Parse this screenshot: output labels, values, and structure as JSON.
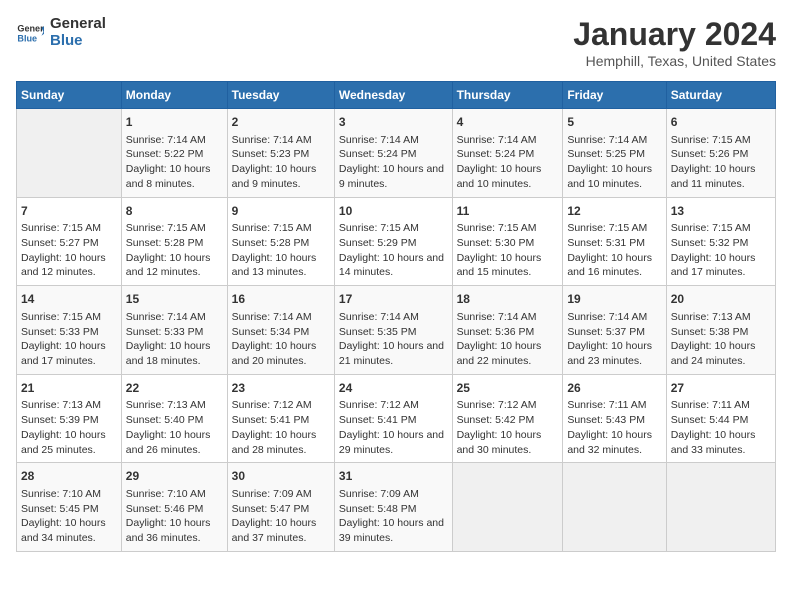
{
  "logo": {
    "text_general": "General",
    "text_blue": "Blue"
  },
  "title": "January 2024",
  "subtitle": "Hemphill, Texas, United States",
  "days_of_week": [
    "Sunday",
    "Monday",
    "Tuesday",
    "Wednesday",
    "Thursday",
    "Friday",
    "Saturday"
  ],
  "weeks": [
    [
      {
        "day": "",
        "sunrise": "",
        "sunset": "",
        "daylight": ""
      },
      {
        "day": "1",
        "sunrise": "Sunrise: 7:14 AM",
        "sunset": "Sunset: 5:22 PM",
        "daylight": "Daylight: 10 hours and 8 minutes."
      },
      {
        "day": "2",
        "sunrise": "Sunrise: 7:14 AM",
        "sunset": "Sunset: 5:23 PM",
        "daylight": "Daylight: 10 hours and 9 minutes."
      },
      {
        "day": "3",
        "sunrise": "Sunrise: 7:14 AM",
        "sunset": "Sunset: 5:24 PM",
        "daylight": "Daylight: 10 hours and 9 minutes."
      },
      {
        "day": "4",
        "sunrise": "Sunrise: 7:14 AM",
        "sunset": "Sunset: 5:24 PM",
        "daylight": "Daylight: 10 hours and 10 minutes."
      },
      {
        "day": "5",
        "sunrise": "Sunrise: 7:14 AM",
        "sunset": "Sunset: 5:25 PM",
        "daylight": "Daylight: 10 hours and 10 minutes."
      },
      {
        "day": "6",
        "sunrise": "Sunrise: 7:15 AM",
        "sunset": "Sunset: 5:26 PM",
        "daylight": "Daylight: 10 hours and 11 minutes."
      }
    ],
    [
      {
        "day": "7",
        "sunrise": "Sunrise: 7:15 AM",
        "sunset": "Sunset: 5:27 PM",
        "daylight": "Daylight: 10 hours and 12 minutes."
      },
      {
        "day": "8",
        "sunrise": "Sunrise: 7:15 AM",
        "sunset": "Sunset: 5:28 PM",
        "daylight": "Daylight: 10 hours and 12 minutes."
      },
      {
        "day": "9",
        "sunrise": "Sunrise: 7:15 AM",
        "sunset": "Sunset: 5:28 PM",
        "daylight": "Daylight: 10 hours and 13 minutes."
      },
      {
        "day": "10",
        "sunrise": "Sunrise: 7:15 AM",
        "sunset": "Sunset: 5:29 PM",
        "daylight": "Daylight: 10 hours and 14 minutes."
      },
      {
        "day": "11",
        "sunrise": "Sunrise: 7:15 AM",
        "sunset": "Sunset: 5:30 PM",
        "daylight": "Daylight: 10 hours and 15 minutes."
      },
      {
        "day": "12",
        "sunrise": "Sunrise: 7:15 AM",
        "sunset": "Sunset: 5:31 PM",
        "daylight": "Daylight: 10 hours and 16 minutes."
      },
      {
        "day": "13",
        "sunrise": "Sunrise: 7:15 AM",
        "sunset": "Sunset: 5:32 PM",
        "daylight": "Daylight: 10 hours and 17 minutes."
      }
    ],
    [
      {
        "day": "14",
        "sunrise": "Sunrise: 7:15 AM",
        "sunset": "Sunset: 5:33 PM",
        "daylight": "Daylight: 10 hours and 17 minutes."
      },
      {
        "day": "15",
        "sunrise": "Sunrise: 7:14 AM",
        "sunset": "Sunset: 5:33 PM",
        "daylight": "Daylight: 10 hours and 18 minutes."
      },
      {
        "day": "16",
        "sunrise": "Sunrise: 7:14 AM",
        "sunset": "Sunset: 5:34 PM",
        "daylight": "Daylight: 10 hours and 20 minutes."
      },
      {
        "day": "17",
        "sunrise": "Sunrise: 7:14 AM",
        "sunset": "Sunset: 5:35 PM",
        "daylight": "Daylight: 10 hours and 21 minutes."
      },
      {
        "day": "18",
        "sunrise": "Sunrise: 7:14 AM",
        "sunset": "Sunset: 5:36 PM",
        "daylight": "Daylight: 10 hours and 22 minutes."
      },
      {
        "day": "19",
        "sunrise": "Sunrise: 7:14 AM",
        "sunset": "Sunset: 5:37 PM",
        "daylight": "Daylight: 10 hours and 23 minutes."
      },
      {
        "day": "20",
        "sunrise": "Sunrise: 7:13 AM",
        "sunset": "Sunset: 5:38 PM",
        "daylight": "Daylight: 10 hours and 24 minutes."
      }
    ],
    [
      {
        "day": "21",
        "sunrise": "Sunrise: 7:13 AM",
        "sunset": "Sunset: 5:39 PM",
        "daylight": "Daylight: 10 hours and 25 minutes."
      },
      {
        "day": "22",
        "sunrise": "Sunrise: 7:13 AM",
        "sunset": "Sunset: 5:40 PM",
        "daylight": "Daylight: 10 hours and 26 minutes."
      },
      {
        "day": "23",
        "sunrise": "Sunrise: 7:12 AM",
        "sunset": "Sunset: 5:41 PM",
        "daylight": "Daylight: 10 hours and 28 minutes."
      },
      {
        "day": "24",
        "sunrise": "Sunrise: 7:12 AM",
        "sunset": "Sunset: 5:41 PM",
        "daylight": "Daylight: 10 hours and 29 minutes."
      },
      {
        "day": "25",
        "sunrise": "Sunrise: 7:12 AM",
        "sunset": "Sunset: 5:42 PM",
        "daylight": "Daylight: 10 hours and 30 minutes."
      },
      {
        "day": "26",
        "sunrise": "Sunrise: 7:11 AM",
        "sunset": "Sunset: 5:43 PM",
        "daylight": "Daylight: 10 hours and 32 minutes."
      },
      {
        "day": "27",
        "sunrise": "Sunrise: 7:11 AM",
        "sunset": "Sunset: 5:44 PM",
        "daylight": "Daylight: 10 hours and 33 minutes."
      }
    ],
    [
      {
        "day": "28",
        "sunrise": "Sunrise: 7:10 AM",
        "sunset": "Sunset: 5:45 PM",
        "daylight": "Daylight: 10 hours and 34 minutes."
      },
      {
        "day": "29",
        "sunrise": "Sunrise: 7:10 AM",
        "sunset": "Sunset: 5:46 PM",
        "daylight": "Daylight: 10 hours and 36 minutes."
      },
      {
        "day": "30",
        "sunrise": "Sunrise: 7:09 AM",
        "sunset": "Sunset: 5:47 PM",
        "daylight": "Daylight: 10 hours and 37 minutes."
      },
      {
        "day": "31",
        "sunrise": "Sunrise: 7:09 AM",
        "sunset": "Sunset: 5:48 PM",
        "daylight": "Daylight: 10 hours and 39 minutes."
      },
      {
        "day": "",
        "sunrise": "",
        "sunset": "",
        "daylight": ""
      },
      {
        "day": "",
        "sunrise": "",
        "sunset": "",
        "daylight": ""
      },
      {
        "day": "",
        "sunrise": "",
        "sunset": "",
        "daylight": ""
      }
    ]
  ]
}
